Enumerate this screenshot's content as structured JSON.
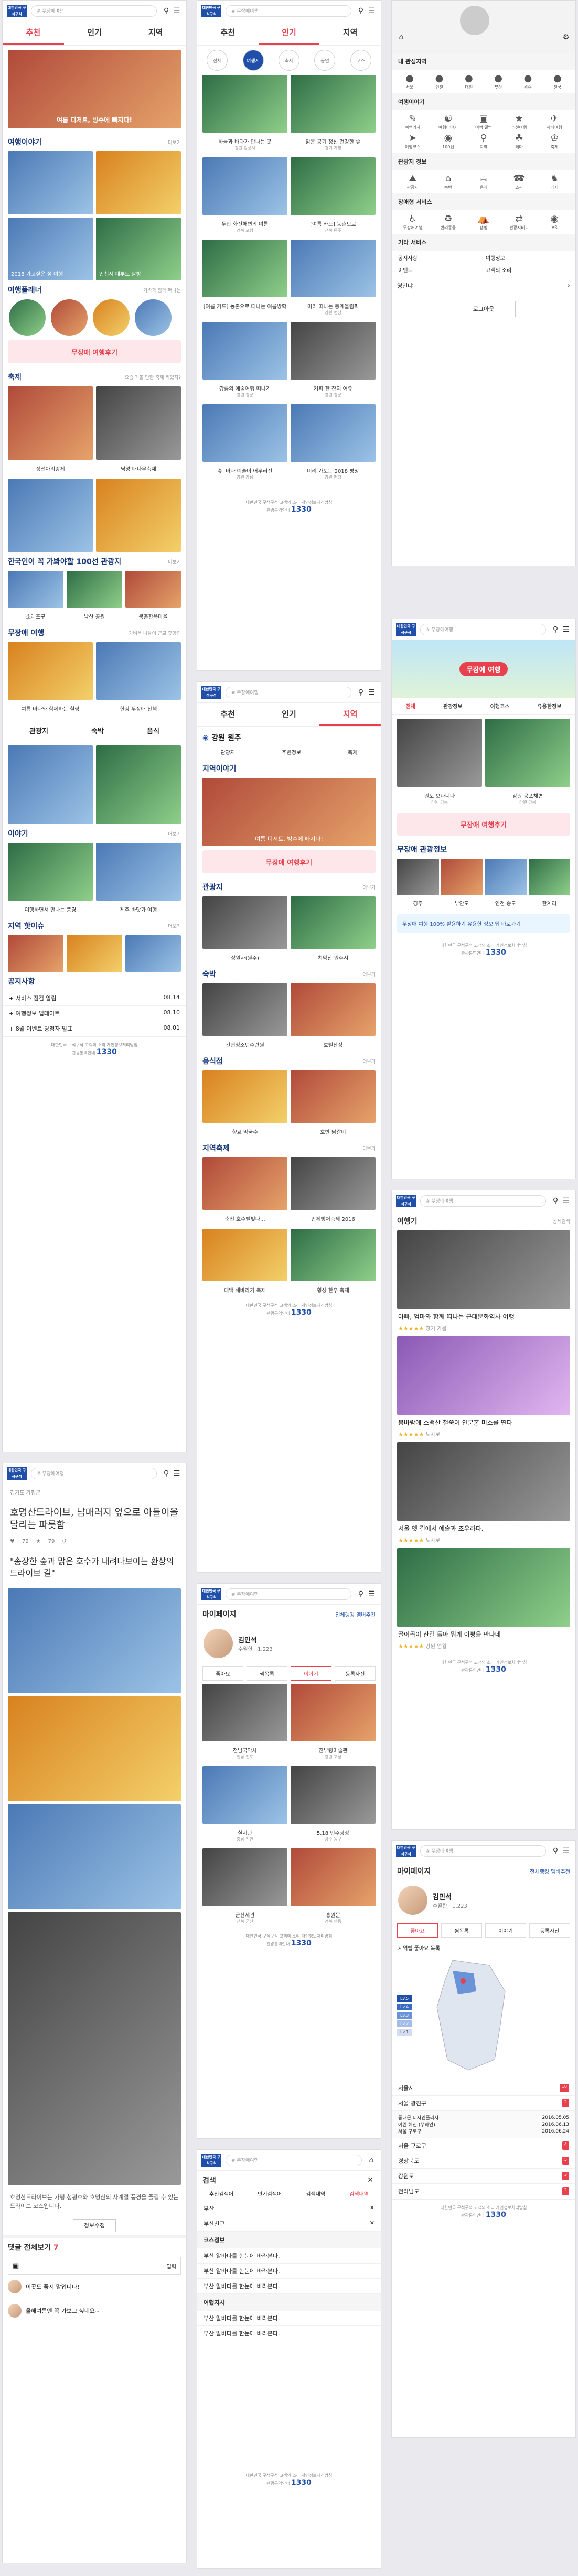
{
  "common": {
    "logo_text": "대한민국 구석구석",
    "search_placeholder": "# 무장애여행",
    "footer_links": "대한민국 구석구석  고객의 소리  개인정보처리방침",
    "footer_1330": "1330",
    "footer_help": "관광통역안내"
  },
  "main": {
    "tabs": [
      "추천",
      "인기",
      "지역"
    ],
    "hero_caption": "여름 디저트, 빙수에 빠지다!",
    "story_section": "여행이야기",
    "story_items": [
      "2018 가고싶은 섬 여행",
      "인천시 대부도 탐방"
    ],
    "course_section": "여행플래너",
    "course_sub": "가족과 함께 떠나는",
    "banner": "무장애 여행후기",
    "festival_section": "축제",
    "festival_sub": "요즘 가볼 만한 축제 뭐있지?",
    "festival_items": [
      "정선아리랑제",
      "담양 대나무축제"
    ],
    "k100_section": "한국인이 꼭 가봐야할 100선 관광지",
    "k100_items": [
      "소래포구",
      "낙산 공원",
      "북촌한옥마을"
    ],
    "barrier_section": "무장애 여행",
    "barrier_sub": "가벼운 나들이 근교 휴양림",
    "barrier_items": [
      "여름 바다와 함께하는 힐링",
      "한강 무장애 산책"
    ],
    "filters": [
      "관광지",
      "숙박",
      "음식"
    ],
    "story2_section": "이야기",
    "story2_items": [
      "여행하면서 만나는 풍경",
      "제주 바닷가 여행"
    ],
    "local_section": "지역 핫이슈",
    "notice_section": "공지사항",
    "notices": [
      {
        "t": "+ 서비스 점검 알림",
        "d": "08.14"
      },
      {
        "t": "+ 여행정보 업데이트",
        "d": "08.10"
      },
      {
        "t": "+ 8월 이벤트 당첨자 발표",
        "d": "08.01"
      }
    ]
  },
  "article": {
    "breadcrumb": "경기도 가평군",
    "headline": "호명산드라이브, 남매러지 옆으로 아들이을 달리는 파릇함",
    "likes": "72",
    "bookmarks": "79",
    "quote": "\"송장한 숲과 맑은 호수가 내려다보이는 환상의 드라이브 길\"",
    "body": "호명산드라이브는 가평 청평호와 호명산의 사계절 풍경을 즐길 수 있는 드라이브 코스입니다.",
    "info_btn": "정보수정",
    "comment_title": "댓글 전체보기",
    "comment_count": "7",
    "comment_submit": "입력",
    "comments": [
      "이곳도 좋지 말입니다!",
      "올해여름엔 꼭 가보고 싶네요~"
    ]
  },
  "popular": {
    "tabs": [
      "추천",
      "인기",
      "지역"
    ],
    "filters": [
      "전체",
      "여행지",
      "축제",
      "공연",
      "코스"
    ],
    "items": [
      {
        "t": "하늘과 바다가 만나는 곳",
        "s": "강원 강릉시"
      },
      {
        "t": "맑은 공기 청신 건강한 숲",
        "s": "경기 가평"
      },
      {
        "t": "두만 화진해변의 여름",
        "s": "경북 포항"
      },
      {
        "t": "[여름 카드] 농촌으로",
        "s": "전북 완주"
      },
      {
        "t": "[여름 카드] 농촌으로 떠나는 여름방학",
        "s": ""
      },
      {
        "t": "미리 떠나는 동계올림픽",
        "s": "강원 평창"
      },
      {
        "t": "강릉의 예술여행 떠나기",
        "s": "강원 강릉"
      },
      {
        "t": "커피 한 잔의 여유",
        "s": "강원 강릉"
      },
      {
        "t": "숲, 바다 예술이 어우러진",
        "s": "강원 강릉"
      },
      {
        "t": "미리 가보는 2018 평창",
        "s": "강원 평창"
      }
    ]
  },
  "region": {
    "tabs": [
      "추천",
      "인기",
      "지역"
    ],
    "region_name": "강원 원주",
    "sub_tabs": [
      "관광지",
      "주변정보",
      "축제"
    ],
    "story_section": "지역이야기",
    "hero_caption": "여름 디저트, 빙수에 빠지다!",
    "banner": "무장애 여행후기",
    "tour_section": "관광지",
    "tour_items": [
      "상원사(원주)",
      "치악산 원주시"
    ],
    "stay_section": "숙박",
    "stay_items": [
      "간현청소년수련원",
      "호텔산장"
    ],
    "food_section": "음식점",
    "food_items": [
      "향교 막국수",
      "호반 닭갈비"
    ],
    "fest_section": "지역축제",
    "fest_items": [
      "춘천 호수별빛나...",
      "인제빙어축제 2016",
      "태백 해바라기 축제",
      "횡성 한우 축제"
    ]
  },
  "mypage1": {
    "title": "마이페이지",
    "edit": "전체랭킹",
    "setting": "멤버추천",
    "name": "김민석",
    "level": "수월한",
    "points": "1,223",
    "tabs": [
      "좋아요",
      "찜목록",
      "이야기",
      "등록사진"
    ],
    "items": [
      {
        "t": "전남국악사",
        "s": "전남 진도"
      },
      {
        "t": "진부령미술관",
        "s": "강원 고성"
      },
      {
        "t": "칠지관",
        "s": "충남 천안"
      },
      {
        "t": "5.18 민주광장",
        "s": "광주 동구"
      },
      {
        "t": "군산세관",
        "s": "전북 군산"
      },
      {
        "t": "흥원문",
        "s": "경북 안동"
      }
    ]
  },
  "searchpage": {
    "title": "검색",
    "tabs": [
      "추천검색어",
      "인기검색어",
      "검색내역",
      "검색내역"
    ],
    "recent": [
      "부산",
      "부산친구"
    ],
    "course_head": "코스정보",
    "course_items": [
      "부산 알바다를 한눈에 바라본다.",
      "부산 알바다를 한눈에 바라본다.",
      "부산 알바다를 한눈에 바라본다."
    ],
    "travel_head": "여행지사",
    "travel_items": [
      "부산 알바다를 한눈에 바라본다.",
      "부산 알바다를 한눈에 바라본다."
    ]
  },
  "menu": {
    "my_region": "내 관심지역",
    "regions": [
      "서울",
      "인천",
      "대전",
      "부산",
      "광주",
      "전국"
    ],
    "travel_story": "여행이야기",
    "travel_icons": [
      "여행기사",
      "여행이야기",
      "여행 앨범",
      "추천여행",
      "해외여행",
      "여행코스",
      "100선",
      "지역",
      "테마",
      "축제"
    ],
    "tour_info": "관광지 정보",
    "tour_icons": [
      "관광지",
      "숙박",
      "음식",
      "쇼핑",
      "레저"
    ],
    "service": "장애형 서비스",
    "service_icons": [
      "무장애여행",
      "반려동물",
      "캠핑",
      "관광지비교",
      "VR"
    ],
    "etc": "기타 서비스",
    "etc_items": [
      "공지사항",
      "여행정보",
      "이벤트",
      "고객의 소리"
    ],
    "language": "영인냐",
    "logout": "로그아웃"
  },
  "barrier": {
    "banner_title": "무장애 여행",
    "tabs": [
      "전체",
      "관광정보",
      "여행코스",
      "유용한정보"
    ],
    "items": [
      {
        "t": "원도 보다니다",
        "s": "강원 강릉"
      },
      {
        "t": "강원 공포체변",
        "s": "강원 강릉"
      }
    ],
    "banner": "무장애 여행후기",
    "tourist_section": "무장애 관광정보",
    "tourist_items": [
      "경주",
      "부안도",
      "인천 송도",
      "한계리"
    ],
    "promo": "무장애 여행 100% 활용하기 유용한 정보 팁 바로가기"
  },
  "travel": {
    "title": "여행기",
    "sort": "상세검색",
    "items": [
      {
        "t": "아빠, 엄마와 함께 떠나는 근대문화역사 여행",
        "a": "장기 가를"
      },
      {
        "t": "봄바람에 소백산 철쭉이 연분홍 미소를 띤다",
        "a": "노사보"
      },
      {
        "t": "서울 옛 길에서 예술과 조우하다.",
        "a": "노사보"
      },
      {
        "t": "골이곱이 산길 돌아 뭐게 이평을 만나네",
        "a": "강원 영월"
      }
    ]
  },
  "mypage2": {
    "title": "마이페이지",
    "edit": "전체랭킹",
    "setting": "멤버추천",
    "name": "김민석",
    "level": "수월한",
    "points": "1,223",
    "tabs": [
      "좋아요",
      "찜목록",
      "이야기",
      "등록사진"
    ],
    "map_label": "지역별 좋아요 목록",
    "levels": [
      "Lv.5",
      "Lv.4",
      "Lv.3",
      "Lv.2",
      "Lv.1"
    ],
    "region_list": [
      {
        "r": "서울시",
        "n": "10"
      },
      {
        "r": "서울 광진구",
        "n": "2"
      },
      {
        "r": "서울 구로구",
        "n": "4"
      },
      {
        "r": "경상북도",
        "n": "5"
      },
      {
        "r": "강원도",
        "n": "3"
      },
      {
        "r": "전라남도",
        "n": "2"
      }
    ],
    "detail": [
      {
        "t": "동대문 디자인플라자",
        "d": "2016.05.05"
      },
      {
        "t": "어린 혜진 (무화인)",
        "d": "2016.06.13"
      },
      {
        "t": "서울 구로구",
        "d": "2016.06.24"
      }
    ]
  }
}
